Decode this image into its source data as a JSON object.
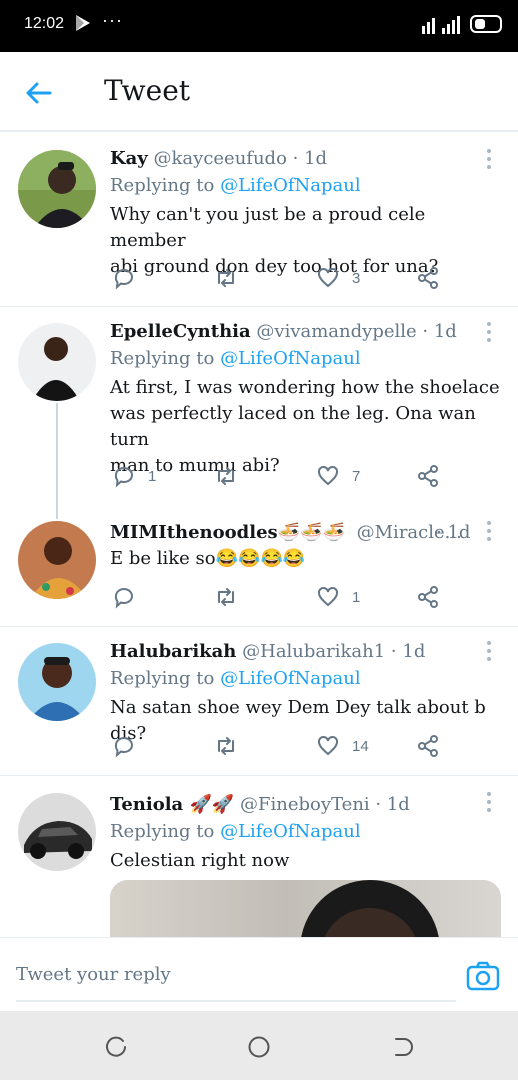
{
  "status_bar": {
    "time": "12:02",
    "dots": "···"
  },
  "header": {
    "title": "Tweet"
  },
  "tweets": [
    {
      "name": "Kay",
      "handle": "@kayceeufudo · 1d",
      "replying_prefix": "Replying to",
      "replying_to": "@LifeOfNapaul",
      "lines": [
        "Why can't you just be a proud cele member",
        "abi ground don dey too hot for una?"
      ],
      "replies": "",
      "likes": "3"
    },
    {
      "name": "EpelleCynthia",
      "handle": "@vivamandypelle · 1d",
      "replying_prefix": "Replying to",
      "replying_to": "@LifeOfNapaul",
      "lines": [
        "At first, I was wondering how the shoelace",
        "was perfectly laced on the leg. Ona wan turn",
        "man to mumu abi?"
      ],
      "replies": "1",
      "likes": "7"
    },
    {
      "name": "MIMIthenoodles🍜🍜🍜",
      "handle": "@Miracle...",
      "time": "· 1d",
      "lines": [
        "E be like so😂😂😂😂"
      ],
      "replies": "",
      "likes": "1"
    },
    {
      "name": "Halubarikah",
      "handle": "@Halubarikah1 · 1d",
      "replying_prefix": "Replying to",
      "replying_to": "@LifeOfNapaul",
      "lines": [
        "Na satan shoe wey Dem Dey talk about b dis?"
      ],
      "replies": "",
      "likes": "14"
    },
    {
      "name": "Teniola 🚀🚀",
      "handle": "@FineboyTeni · 1d",
      "replying_prefix": "Replying to",
      "replying_to": "@LifeOfNapaul",
      "lines": [
        "Celestian right now"
      ]
    }
  ],
  "reply_bar": {
    "placeholder": "Tweet your reply"
  },
  "colors": {
    "accent": "#1da1f2",
    "muted": "#657786",
    "text": "#14171a",
    "separator": "#e6ecf0"
  }
}
